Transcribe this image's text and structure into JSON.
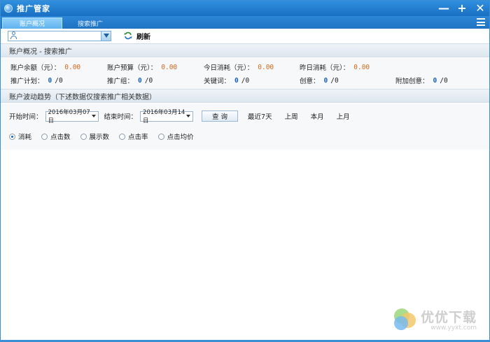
{
  "window": {
    "title": "推广管家"
  },
  "tabs": [
    {
      "label": "账户概况",
      "active": true
    },
    {
      "label": "搜索推广",
      "active": false
    }
  ],
  "toolbar": {
    "account_value": "",
    "refresh_label": "刷新"
  },
  "overview": {
    "header": "账户概况 - 搜索推广",
    "money": [
      {
        "label": "账户余额（元）：",
        "value": "0.00"
      },
      {
        "label": "账户预算（元）：",
        "value": "0.00"
      },
      {
        "label": "今日消耗（元）：",
        "value": "0.00"
      },
      {
        "label": "昨日消耗（元）：",
        "value": "0.00"
      }
    ],
    "counts": [
      {
        "label": "推广计划：",
        "value": "0",
        "total": "/0"
      },
      {
        "label": "推广组：",
        "value": "0",
        "total": "/0"
      },
      {
        "label": "关键词：",
        "value": "0",
        "total": "/0"
      },
      {
        "label": "创意：",
        "value": "0",
        "total": "/0"
      },
      {
        "label": "附加创意：",
        "value": "0",
        "total": "/0"
      }
    ]
  },
  "trend": {
    "header": "账户波动趋势（下述数据仅搜索推广相关数据）",
    "start_label": "开始时间：",
    "start_date": "2016年03月07日",
    "end_label": "结束时间：",
    "end_date": "2016年03月14日",
    "query_label": "查 询",
    "quick_links": [
      "最近7天",
      "上周",
      "本月",
      "上月"
    ],
    "metrics": [
      {
        "label": "消耗",
        "checked": true
      },
      {
        "label": "点击数",
        "checked": false
      },
      {
        "label": "展示数",
        "checked": false
      },
      {
        "label": "点击率",
        "checked": false
      },
      {
        "label": "点击均价",
        "checked": false
      }
    ]
  },
  "watermark": {
    "text": "优优下载",
    "url": "www.yyxt.com"
  },
  "colors": {
    "titlebar": "#1a6fc2",
    "accent_blue": "#1a5fb4",
    "money_orange": "#d2691e"
  }
}
